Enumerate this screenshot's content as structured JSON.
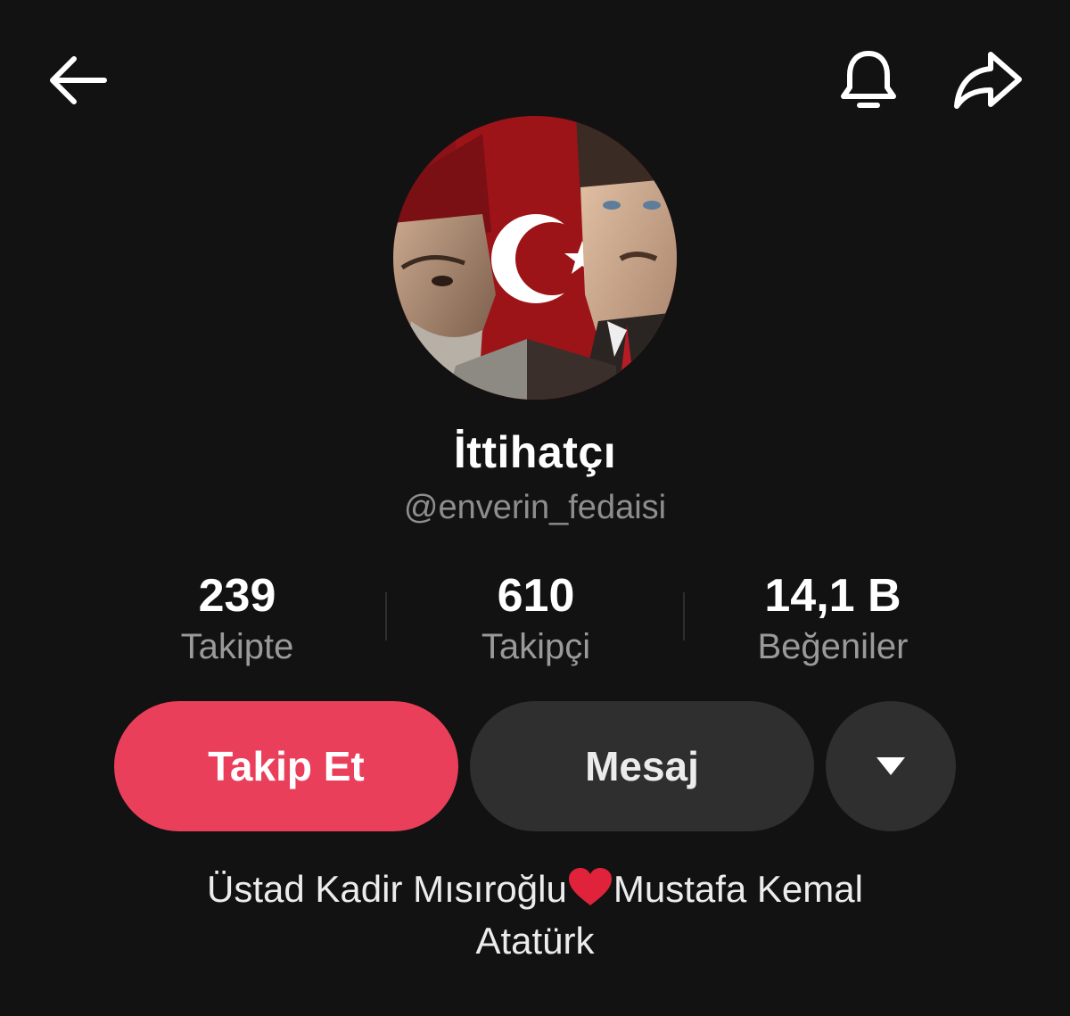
{
  "header": {
    "back_icon": "arrow-left-icon",
    "notification_icon": "bell-icon",
    "share_icon": "share-arrow-icon"
  },
  "profile": {
    "display_name": "İttihatçı",
    "username": "@enverin_fedaisi",
    "avatar": "avatar-image"
  },
  "stats": [
    {
      "value": "239",
      "label": "Takipte"
    },
    {
      "value": "610",
      "label": "Takipçi"
    },
    {
      "value": "14,1 B",
      "label": "Beğeniler"
    }
  ],
  "actions": {
    "follow_label": "Takip Et",
    "message_label": "Mesaj",
    "more_icon": "caret-down-icon"
  },
  "bio": {
    "line1_before": "Üstad Kadir Mısıroğlu",
    "emoji": "heart-icon",
    "line1_after": "Mustafa Kemal",
    "line2": "Atatürk"
  },
  "colors": {
    "background": "#121212",
    "follow_button": "#ea3f5a",
    "secondary_button": "#2f2f2f",
    "muted_text": "#8e8e8e",
    "heart": "#e0233b"
  }
}
